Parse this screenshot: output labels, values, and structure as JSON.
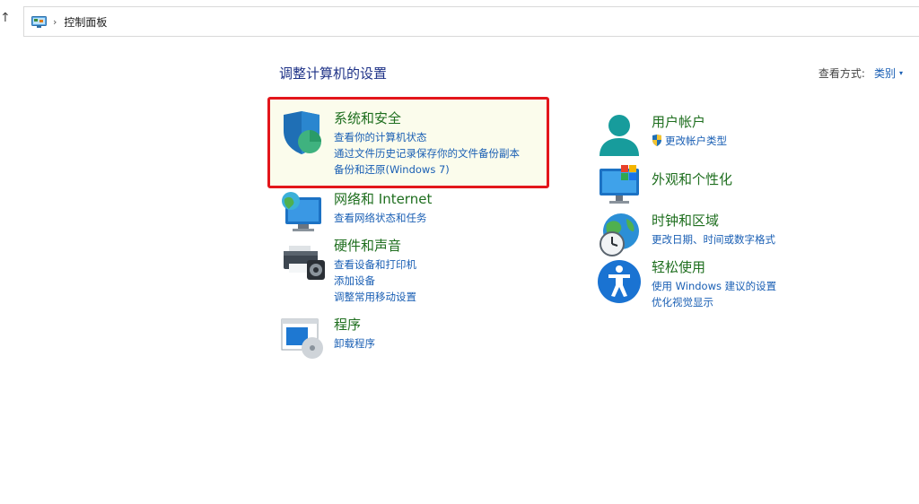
{
  "address": {
    "up_glyph": "↑",
    "separator": "›",
    "path": "控制面板"
  },
  "header": {
    "title": "调整计算机的设置",
    "view_by_label": "查看方式:",
    "view_by_value": "类别",
    "view_by_caret": "▾"
  },
  "categories": {
    "system_security": {
      "title": "系统和安全",
      "links": [
        "查看你的计算机状态",
        "通过文件历史记录保存你的文件备份副本",
        "备份和还原(Windows 7)"
      ]
    },
    "network": {
      "title": "网络和 Internet",
      "links": [
        "查看网络状态和任务"
      ]
    },
    "hardware": {
      "title": "硬件和声音",
      "links": [
        "查看设备和打印机",
        "添加设备",
        "调整常用移动设置"
      ]
    },
    "programs": {
      "title": "程序",
      "links": [
        "卸载程序"
      ]
    },
    "user_accounts": {
      "title": "用户帐户",
      "links": [
        "更改帐户类型"
      ]
    },
    "appearance": {
      "title": "外观和个性化",
      "links": []
    },
    "clock_region": {
      "title": "时钟和区域",
      "links": [
        "更改日期、时间或数字格式"
      ]
    },
    "ease_of_access": {
      "title": "轻松使用",
      "links": [
        "使用 Windows 建议的设置",
        "优化视觉显示"
      ]
    }
  },
  "colors": {
    "title_blue": "#1e3287",
    "category_green": "#1e6e1e",
    "link_blue": "#1a5fb4",
    "highlight_red": "#e3161b"
  }
}
